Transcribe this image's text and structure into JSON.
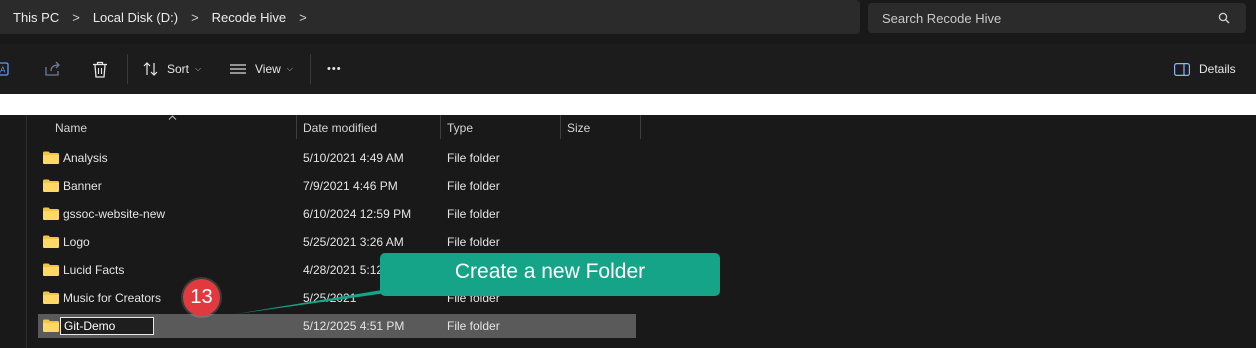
{
  "address": {
    "crumbs": [
      "This PC",
      "Local Disk (D:)",
      "Recode Hive"
    ],
    "chevron": ">"
  },
  "search": {
    "placeholder": "Search Recode Hive"
  },
  "toolbar": {
    "sort_label": "Sort",
    "view_label": "View",
    "more_label": "•••",
    "details_label": "Details"
  },
  "columns": {
    "name": "Name",
    "date": "Date modified",
    "type": "Type",
    "size": "Size"
  },
  "files": [
    {
      "name": "Analysis",
      "date": "5/10/2021 4:49 AM",
      "type": "File folder"
    },
    {
      "name": "Banner",
      "date": "7/9/2021 4:46 PM",
      "type": "File folder"
    },
    {
      "name": "gssoc-website-new",
      "date": "6/10/2024 12:59 PM",
      "type": "File folder"
    },
    {
      "name": "Logo",
      "date": "5/25/2021 3:26 AM",
      "type": "File folder"
    },
    {
      "name": "Lucid Facts",
      "date": "4/28/2021 5:12",
      "type": ""
    },
    {
      "name": "Music for Creators",
      "date": "5/25/2021",
      "type": "File folder"
    }
  ],
  "new_folder": {
    "name": "Git-Demo",
    "date": "5/12/2025 4:51 PM",
    "type": "File folder"
  },
  "annotation": {
    "callout": "Create a new Folder",
    "step": "13"
  },
  "colors": {
    "accent_callout": "#16a488",
    "badge": "#e0393e",
    "folder": "#f4c542",
    "selection": "#5a5a5a"
  }
}
